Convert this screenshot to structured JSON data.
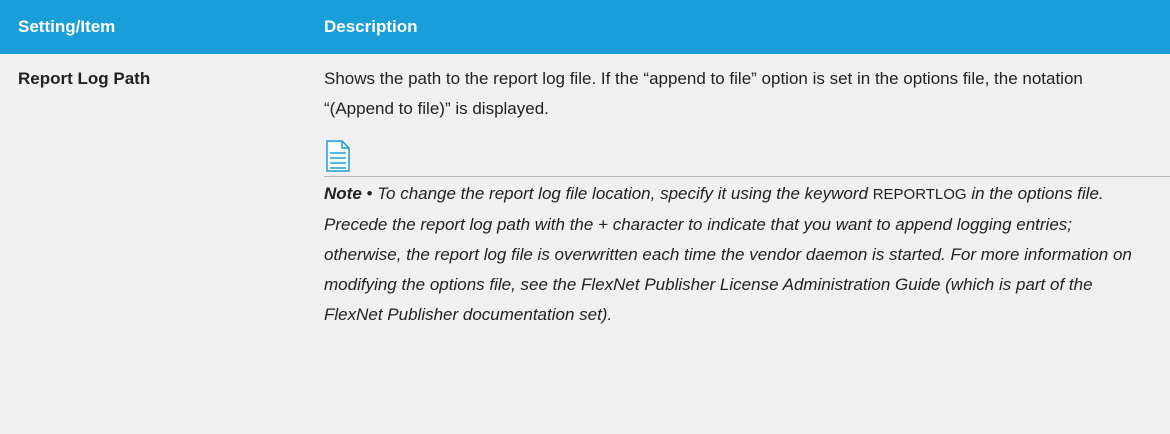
{
  "table": {
    "headers": [
      "Setting/Item",
      "Description"
    ],
    "rows": [
      {
        "setting": "Report Log Path",
        "description": "Shows the path to the report log file. If the “append to file” option is set in the options file, the notation “(Append to file)” is displayed.",
        "note": {
          "icon": "note-document-icon",
          "label": "Note",
          "separator": " • ",
          "text_before_keyword": "To change the report log file location, specify it using the keyword ",
          "keyword": "REPORTLOG",
          "text_after_keyword": " in the options file. Precede the report log path with the + character to indicate that you want to append logging entries; otherwise, the report log file is overwritten each time the vendor daemon is started. For more information on modifying the options file, see the FlexNet Publisher License Administration Guide (which is part of the FlexNet Publisher documentation set)."
        }
      }
    ]
  },
  "colors": {
    "header_background": "#1a9ed9",
    "header_text": "#ffffff",
    "cell_background": "#f0f0f0",
    "icon_accent": "#1a9ed9"
  }
}
